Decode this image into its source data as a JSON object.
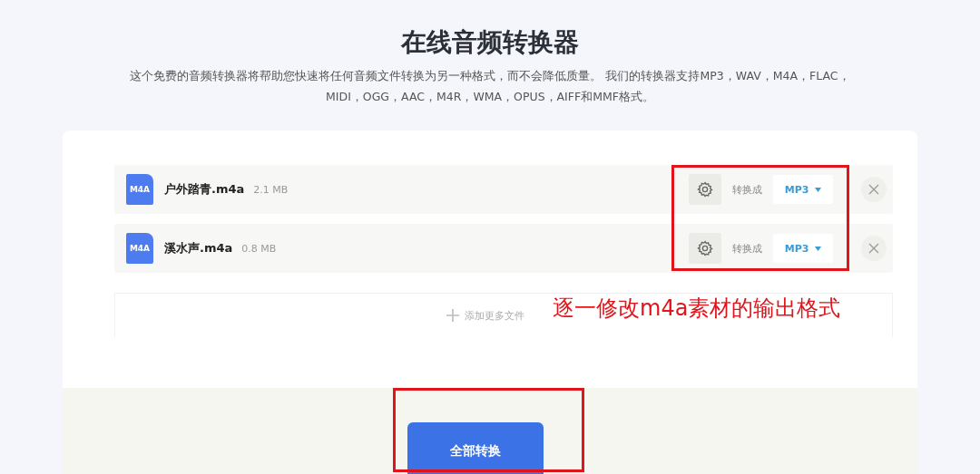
{
  "title": "在线音频转换器",
  "description": [
    "这个免费的音频转换器将帮助您快速将任何音频文件转换为另一种格式，而不会降低质量。 我们的转换器支持MP3，WAV，M4A，FLAC，",
    "MIDI，OGG，AAC，M4R，WMA，OPUS，AIFF和MMF格式。"
  ],
  "files": [
    {
      "icon_label": "M4A",
      "name": "户外踏青.m4a",
      "size": "2.1 MB",
      "convert_label": "转换成",
      "format": "MP3"
    },
    {
      "icon_label": "M4A",
      "name": "溪水声.m4a",
      "size": "0.8 MB",
      "convert_label": "转换成",
      "format": "MP3"
    }
  ],
  "add_more": "添加更多文件",
  "convert_all_button": "全部转换",
  "annotation": {
    "text": "逐一修改m4a素材的输出格式"
  }
}
